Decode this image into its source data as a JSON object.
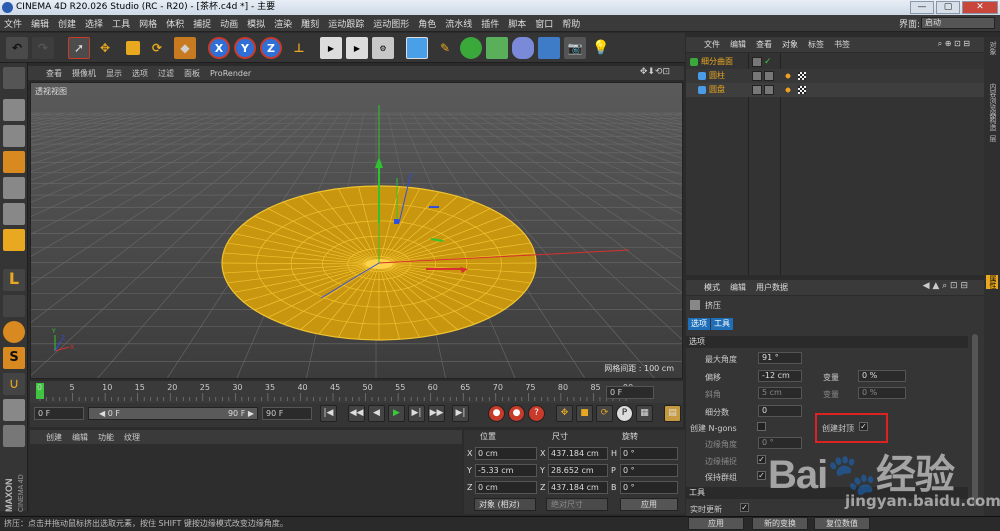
{
  "window": {
    "title": "CINEMA 4D R20.026 Studio (RC - R20) - [茶杯.c4d *] - 主要",
    "buttons": [
      "—",
      "▢",
      "✕"
    ]
  },
  "menubar": {
    "items": [
      "文件",
      "编辑",
      "创建",
      "选择",
      "工具",
      "网格",
      "体积",
      "捕捉",
      "动画",
      "模拟",
      "渲染",
      "雕刻",
      "运动跟踪",
      "运动图形",
      "角色",
      "流水线",
      "插件",
      "脚本",
      "窗口",
      "帮助"
    ],
    "layout_label": "界面:",
    "layout_value": "启动"
  },
  "toolbar": {
    "axis_x": "X",
    "axis_y": "Y",
    "axis_z": "Z"
  },
  "viewport": {
    "menu": [
      "查看",
      "摄像机",
      "显示",
      "选项",
      "过滤",
      "面板",
      "ProRender"
    ],
    "label": "透视视图",
    "grid_spacing": "网格间距 : 100 cm",
    "nav_icons": "✥⬇⟲⊡"
  },
  "timeline": {
    "ticks": [
      "0",
      "5",
      "10",
      "15",
      "20",
      "25",
      "30",
      "35",
      "40",
      "45",
      "50",
      "55",
      "60",
      "65",
      "70",
      "75",
      "80",
      "85",
      "90"
    ],
    "frame": "0 F"
  },
  "playback": {
    "start": "0 F",
    "range_start": "◀ 0 F",
    "range_end": "90 F ▶",
    "end": "90 F",
    "buttons": [
      "|◀",
      "◀◀",
      "◀",
      "▶",
      "▶|",
      "▶▶",
      "▶|"
    ]
  },
  "materials": {
    "menu": [
      "创建",
      "编辑",
      "功能",
      "纹理"
    ]
  },
  "coordinates": {
    "headers": [
      "位置",
      "尺寸",
      "旋转"
    ],
    "rows": [
      {
        "axis": "X",
        "pos": "0 cm",
        "size_axis": "X",
        "size": "437.184 cm",
        "rot_axis": "H",
        "rot": "0 °"
      },
      {
        "axis": "Y",
        "pos": "-5.33 cm",
        "size_axis": "Y",
        "size": "28.652 cm",
        "rot_axis": "P",
        "rot": "0 °"
      },
      {
        "axis": "Z",
        "pos": "0 cm",
        "size_axis": "Z",
        "size": "437.184 cm",
        "rot_axis": "B",
        "rot": "0 °"
      }
    ],
    "mode": "对象 (相对)",
    "size_mode": "绝对尺寸",
    "apply": "应用"
  },
  "status": "挤压：点击并拖动鼠标挤出选取元素，按住 SHIFT 键按边缘模式改变边缘角度。",
  "object_manager": {
    "menu": [
      "文件",
      "编辑",
      "查看",
      "对象",
      "标签",
      "书签"
    ],
    "tools": "⌕ ⊕ ⊡ ⊟",
    "objects": [
      {
        "name": "细分曲面",
        "level": 0
      },
      {
        "name": "圆柱",
        "level": 1
      },
      {
        "name": "圆盘",
        "level": 1
      }
    ]
  },
  "side_tabs": [
    "对象",
    "内容浏览器",
    "构造",
    "层",
    "属性"
  ],
  "attribute_manager": {
    "menu": [
      "模式",
      "编辑",
      "用户数据"
    ],
    "tool_title": "挤压",
    "tabs": [
      "选项",
      "工具"
    ],
    "section_options": "选项",
    "max_angle_label": "最大角度",
    "max_angle_value": "91 °",
    "offset_label": "偏移",
    "offset_value": "-12 cm",
    "variance1_label": "变量",
    "variance1_value": "0 %",
    "bevel_label": "斜角",
    "bevel_value": "5 cm",
    "variance2_label": "变量",
    "variance2_value": "0 %",
    "subdiv_label": "细分数",
    "subdiv_value": "0",
    "ngons_label": "创建 N-gons",
    "create_caps_label": "创建封顶",
    "edge_angle_label": "边缘角度",
    "edge_angle_value": "0 °",
    "edge_snap_label": "边缘捕捉",
    "keep_groups_label": "保持群组",
    "section_tool": "工具",
    "realtime_label": "实时更新",
    "apply": "应用",
    "new_transform": "新的变换",
    "reset": "复位数值",
    "check": "✓"
  },
  "watermark": {
    "text": "Bai🐾经验",
    "url": "jingyan.baidu.com"
  },
  "brand": {
    "maxon": "MAXON",
    "c4d": "CINEMA 4D"
  },
  "colors": {
    "accent": "#e8a820",
    "selection": "#1e6fb8",
    "highlight": "#dd2222"
  }
}
